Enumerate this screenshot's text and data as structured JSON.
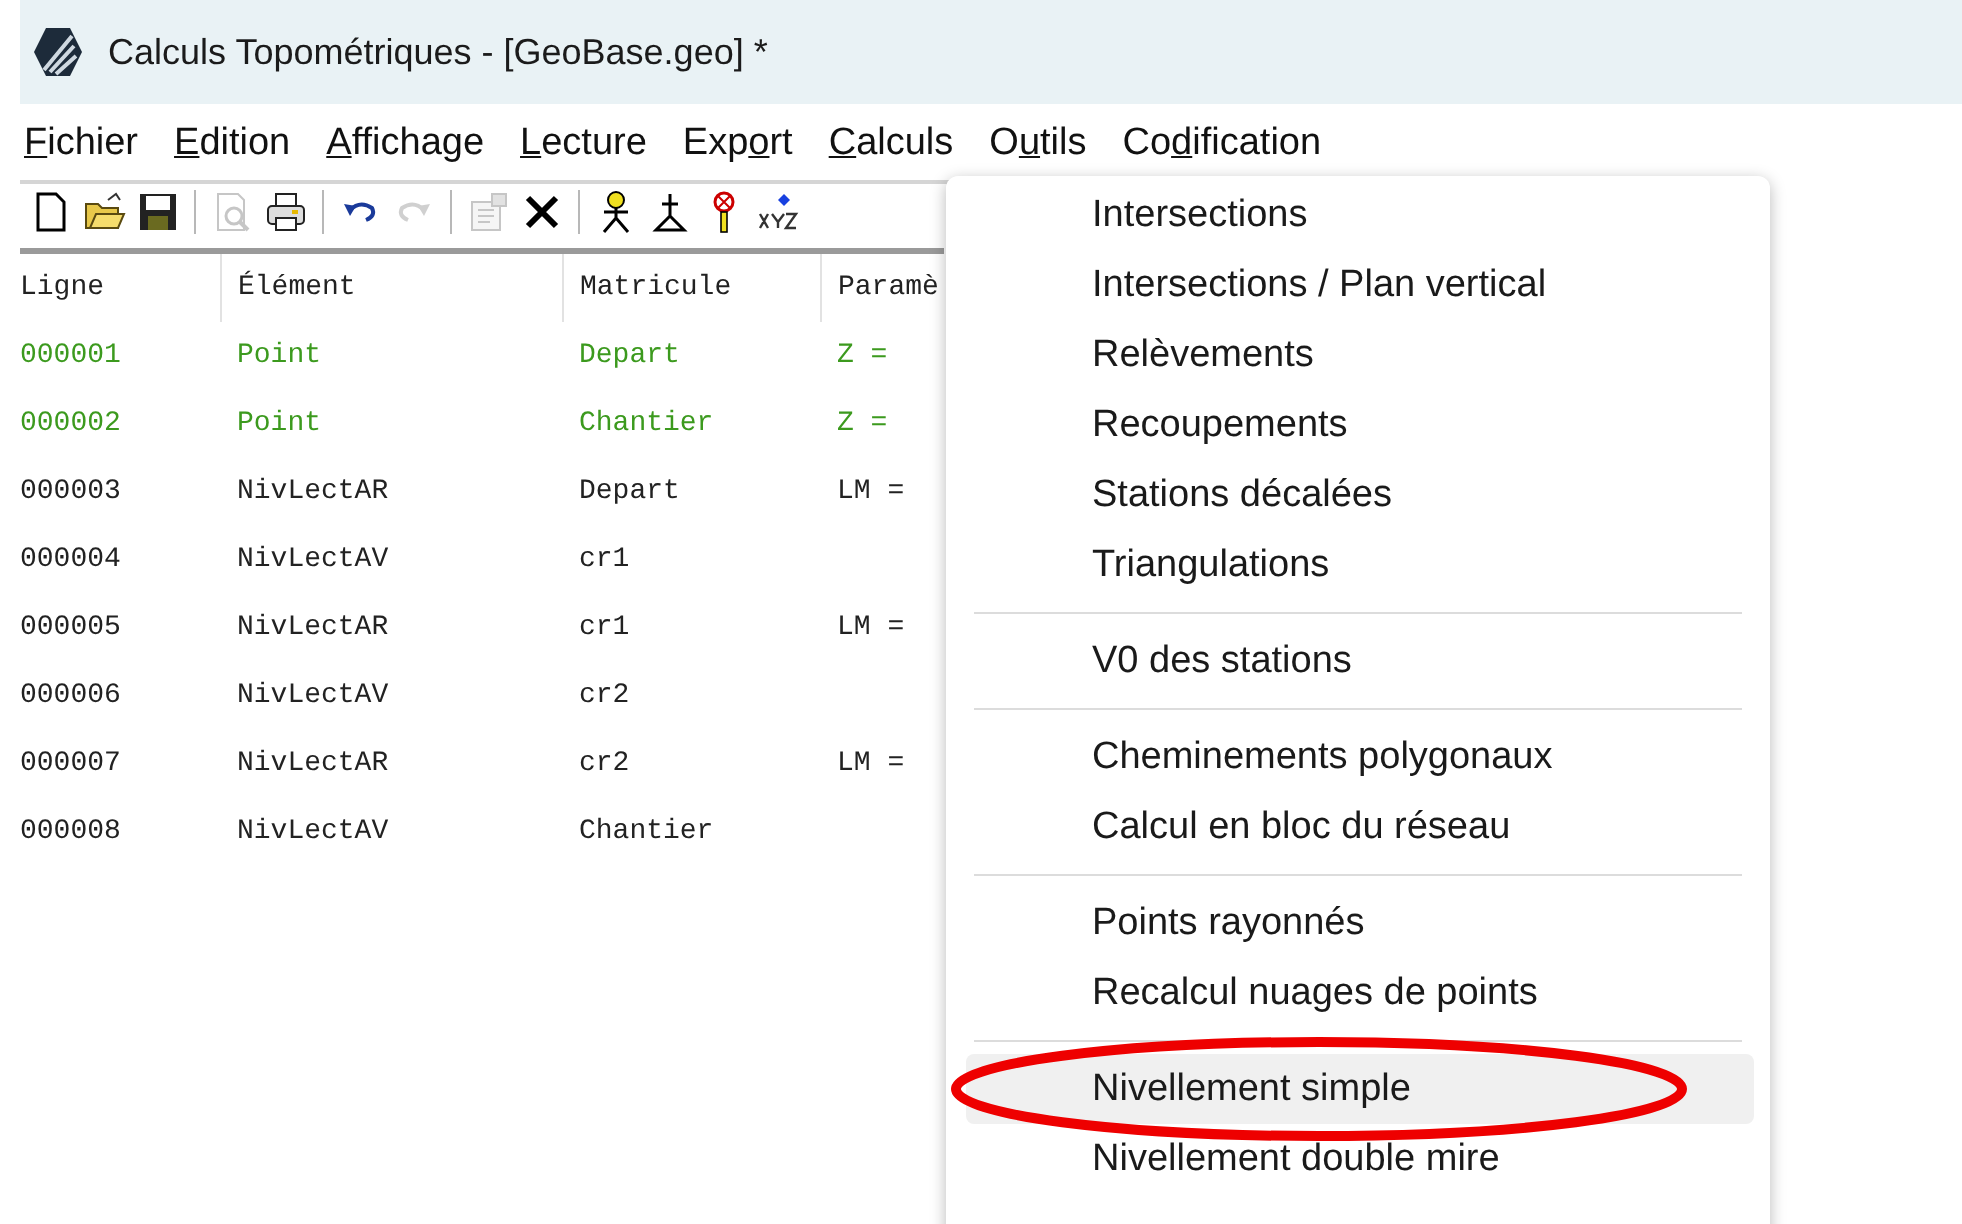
{
  "window": {
    "title": "Calculs Topométriques - [GeoBase.geo] *"
  },
  "menu_bar": [
    {
      "key": "F",
      "after": "ichier"
    },
    {
      "key": "E",
      "after": "dition"
    },
    {
      "key": "A",
      "after": "ffichage"
    },
    {
      "key": "L",
      "after": "ecture"
    },
    {
      "before": "Exp",
      "key": "o",
      "after": "rt"
    },
    {
      "key": "C",
      "after": "alculs"
    },
    {
      "before": "O",
      "key": "u",
      "after": "tils"
    },
    {
      "before": "Co",
      "key": "d",
      "after": "ification"
    }
  ],
  "toolbar": [
    {
      "kind": "new",
      "disabled": false
    },
    {
      "kind": "open",
      "disabled": false
    },
    {
      "kind": "save",
      "disabled": false
    },
    {
      "kind": "separator"
    },
    {
      "kind": "preview",
      "disabled": true
    },
    {
      "kind": "print",
      "disabled": false
    },
    {
      "kind": "separator"
    },
    {
      "kind": "undo",
      "disabled": false
    },
    {
      "kind": "redo",
      "disabled": true
    },
    {
      "kind": "separator"
    },
    {
      "kind": "properties",
      "disabled": true
    },
    {
      "kind": "delete",
      "disabled": false
    },
    {
      "kind": "separator"
    },
    {
      "kind": "station",
      "disabled": false
    },
    {
      "kind": "tripod",
      "disabled": false
    },
    {
      "kind": "target",
      "disabled": false
    },
    {
      "kind": "xyz",
      "disabled": false
    }
  ],
  "table": {
    "columns": [
      "Ligne",
      "Élément",
      "Matricule",
      "Paramè"
    ],
    "rows": [
      {
        "cells": [
          "000001",
          "Point",
          "Depart",
          "Z ="
        ],
        "color": "#3c9a1e"
      },
      {
        "cells": [
          "000002",
          "Point",
          "Chantier",
          "Z ="
        ],
        "color": "#3c9a1e"
      },
      {
        "cells": [
          "000003",
          "NivLectAR",
          "Depart",
          "LM ="
        ],
        "color": "#222222"
      },
      {
        "cells": [
          "000004",
          "NivLectAV",
          "cr1",
          ""
        ],
        "color": "#222222"
      },
      {
        "cells": [
          "000005",
          "NivLectAR",
          "cr1",
          "LM ="
        ],
        "color": "#222222"
      },
      {
        "cells": [
          "000006",
          "NivLectAV",
          "cr2",
          ""
        ],
        "color": "#222222"
      },
      {
        "cells": [
          "000007",
          "NivLectAR",
          "cr2",
          "LM ="
        ],
        "color": "#222222"
      },
      {
        "cells": [
          "000008",
          "NivLectAV",
          "Chantier",
          ""
        ],
        "color": "#222222"
      }
    ]
  },
  "dropdown": {
    "items": [
      {
        "kind": "item",
        "label": "Intersections",
        "hovered": false,
        "circled": false
      },
      {
        "kind": "item",
        "label": "Intersections / Plan vertical",
        "hovered": false,
        "circled": false
      },
      {
        "kind": "item",
        "label": "Relèvements",
        "hovered": false,
        "circled": false
      },
      {
        "kind": "item",
        "label": "Recoupements",
        "hovered": false,
        "circled": false
      },
      {
        "kind": "item",
        "label": "Stations décalées",
        "hovered": false,
        "circled": false
      },
      {
        "kind": "item",
        "label": "Triangulations",
        "hovered": false,
        "circled": false
      },
      {
        "kind": "separator"
      },
      {
        "kind": "item",
        "label": "V0 des stations",
        "hovered": false,
        "circled": false
      },
      {
        "kind": "separator"
      },
      {
        "kind": "item",
        "label": "Cheminements polygonaux",
        "hovered": false,
        "circled": false
      },
      {
        "kind": "item",
        "label": "Calcul en bloc du réseau",
        "hovered": false,
        "circled": false
      },
      {
        "kind": "separator"
      },
      {
        "kind": "item",
        "label": "Points rayonnés",
        "hovered": false,
        "circled": false
      },
      {
        "kind": "item",
        "label": "Recalcul nuages de points",
        "hovered": false,
        "circled": false
      },
      {
        "kind": "separator"
      },
      {
        "kind": "item",
        "label": "Nivellement simple",
        "hovered": true,
        "circled": true
      },
      {
        "kind": "item",
        "label": "Nivellement double mire",
        "hovered": false,
        "circled": false
      }
    ]
  }
}
